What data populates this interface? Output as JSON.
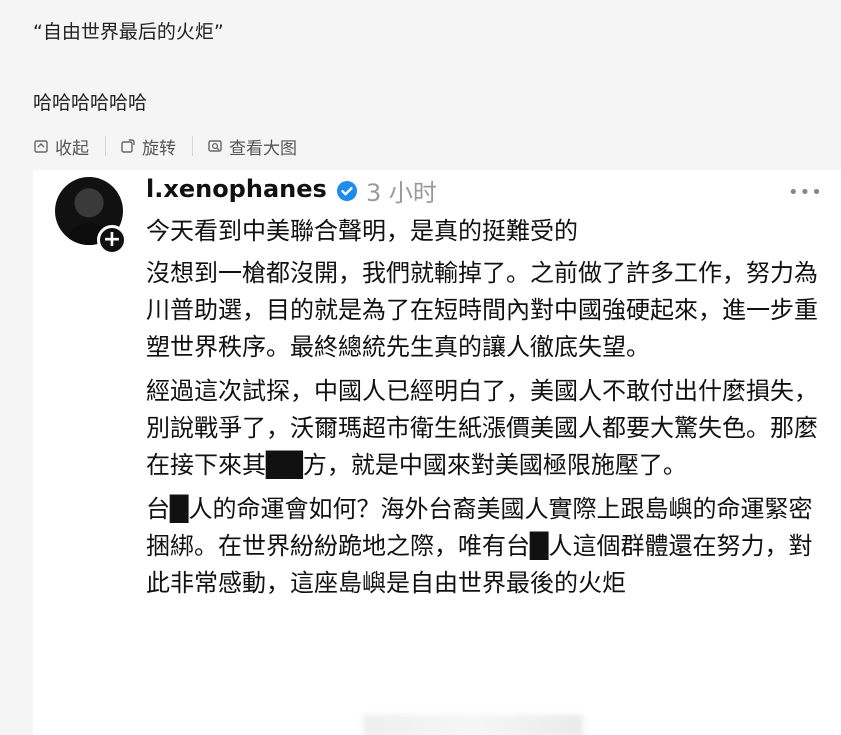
{
  "comment": {
    "top_cut_text": "",
    "quote": "“自由世界最后的火炬”",
    "laugh": "哈哈哈哈哈哈"
  },
  "toolbar": {
    "collapse_label": "收起",
    "rotate_label": "旋转",
    "view_large_label": "查看大图"
  },
  "post": {
    "username": "l.xenophanes",
    "time": "3 小时",
    "paragraphs": [
      "今天看到中美聯合聲明，是真的挺難受的",
      "沒想到一槍都沒開，我們就輸掉了。之前做了許多工作，努力為川普助選，目的就是為了在短時間內對中國強硬起來，進一步重塑世界秩序。最終總統先生真的讓人徹底失望。",
      "經過這次試探，中國人已經明白了，美國人不敢付出什麼損失，別說戰爭了，沃爾瑪超市衛生紙漲價美國人都要大驚失色。那麼在接下來其██方，就是中國來對美國極限施壓了。",
      "台█人的命運會如何？海外台裔美國人實際上跟島嶼的命運緊密捆綁。在世界紛紛跪地之際，唯有台█人這個群體還在努力，對此非常感動，這座島嶼是自由世界最後的火炬"
    ]
  }
}
